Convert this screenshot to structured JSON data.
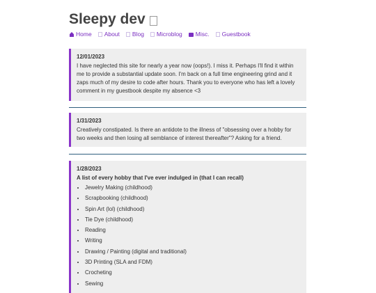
{
  "site": {
    "title": "Sleepy dev"
  },
  "nav": [
    {
      "label": "Home",
      "icon": "home-icon"
    },
    {
      "label": "About",
      "icon": "placeholder-icon"
    },
    {
      "label": "Blog",
      "icon": "placeholder-icon"
    },
    {
      "label": "Microblog",
      "icon": "placeholder-icon"
    },
    {
      "label": "Misc.",
      "icon": "folder-icon"
    },
    {
      "label": "Guestbook",
      "icon": "placeholder-icon"
    }
  ],
  "posts": [
    {
      "date": "12/01/2023",
      "body": "I have neglected this site for nearly a year now (oops!). I miss it. Perhaps I'll find it within me to provide a substantial update soon. I'm back on a full time engineering grind and it zaps much of my desire to code after hours. Thank you to everyone who has left a lovely comment in my guestbook despite my absence <3"
    },
    {
      "date": "1/31/2023",
      "body": "Creatively constipated. Is there an antidote to the illness of \"obsessing over a hobby for two weeks and then losing all semblance of interest thereafter\"? Asking for a friend."
    },
    {
      "date": "1/28/2023",
      "heading": "A list of every hobby that I've ever indulged in (that I can recall)",
      "items": [
        "Jewelry Making (childhood)",
        "Scrapbooking (childhood)",
        "Spin Art (lol) (childhood)",
        "Tie Dye (childhood)",
        "Reading",
        "Writing",
        "Drawing / Painting (digital and traditional)",
        "3D Printing (SLA and FDM)",
        "Crocheting",
        "Sewing"
      ]
    }
  ],
  "colors": {
    "accent": "#8a35c9",
    "link": "#7b2fc1",
    "separator": "#2e5f7d",
    "post_bg": "#eeeeee"
  }
}
